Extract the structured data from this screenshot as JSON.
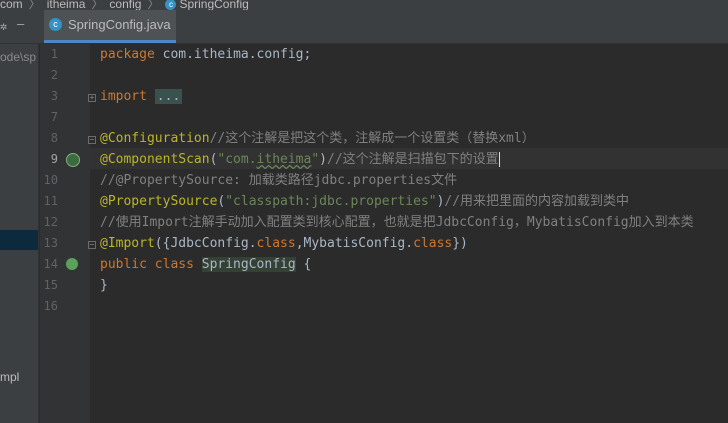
{
  "breadcrumb": {
    "items": [
      "com",
      "itheima",
      "config",
      "SpringConfig"
    ]
  },
  "tab": {
    "label": "SpringConfig.java",
    "icon_letter": "c"
  },
  "project_panel": {
    "path_text": "ode\\sp",
    "bottom_text": "mpl"
  },
  "gutter": {
    "line_numbers": [
      "1",
      "2",
      "3",
      "7",
      "8",
      "9",
      "10",
      "11",
      "12",
      "13",
      "14",
      "15",
      "16"
    ]
  },
  "code": {
    "l1_kw": "package",
    "l1_rest": " com.itheima.config;",
    "l3_kw": "import",
    "l3_folded": "...",
    "l8_ann": "@Configuration",
    "l8_cmt": "//这个注解是把这个类，注解成一个设置类（替换xml）",
    "l9_ann": "@ComponentScan",
    "l9_p1": "(",
    "l9_str1": "\"com.",
    "l9_str2": "itheima",
    "l9_str3": "\"",
    "l9_p2": ")",
    "l9_cmt": "//这个注解是扫描包下的设置",
    "l10_cmt": "//@PropertySource: 加载类路径jdbc.properties文件",
    "l11_ann": "@PropertySource",
    "l11_p1": "(",
    "l11_str": "\"classpath:jdbc.properties\"",
    "l11_p2": ")",
    "l11_cmt": "//用来把里面的内容加载到类中",
    "l12_cmt": "//使用Import注解手动加入配置类到核心配置，也就是把JdbcConfig，MybatisConfig加入到本类",
    "l13_ann": "@Import",
    "l13_p1": "({JdbcConfig.",
    "l13_kw1": "class",
    "l13_p2": ",MybatisConfig.",
    "l13_kw2": "class",
    "l13_p3": "})",
    "l14_kw": "public class",
    "l14_sp": " ",
    "l14_name": "SpringConfig",
    "l14_rest": " {",
    "l15": "}"
  },
  "colors": {
    "keyword": "#cc7832",
    "annotation": "#bbb529",
    "string": "#6a8759",
    "comment": "#808080",
    "text": "#a9b7c6",
    "background": "#2b2b2b",
    "tab_underline": "#4a88c7"
  }
}
